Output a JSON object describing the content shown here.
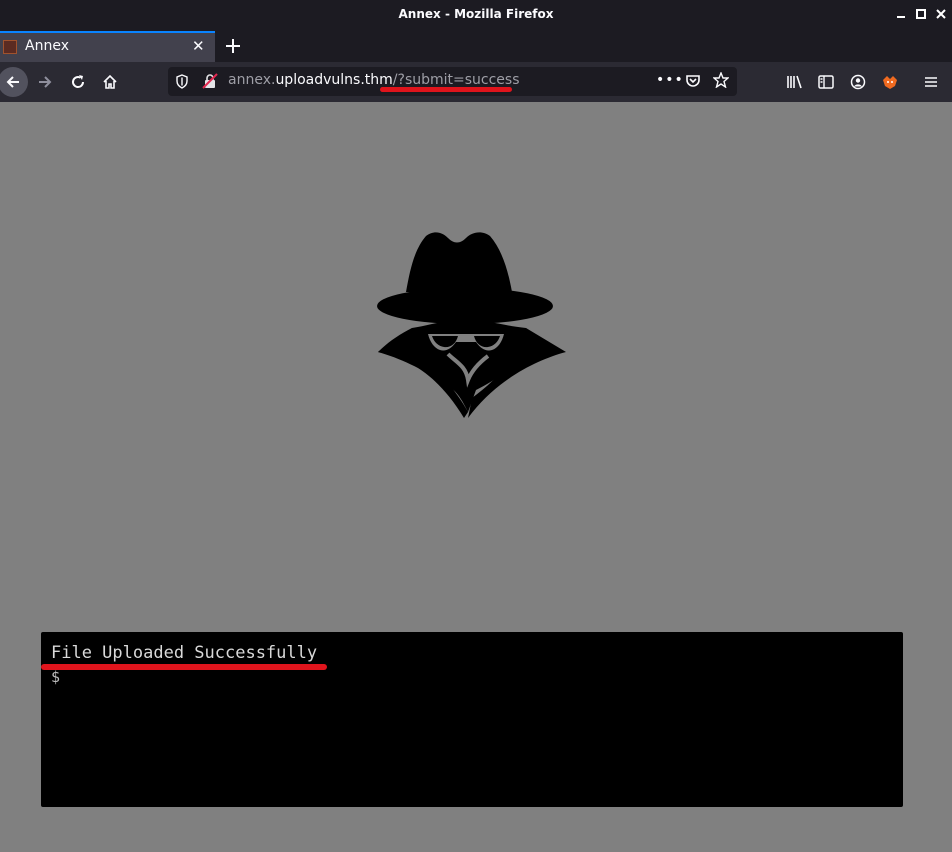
{
  "window": {
    "title": "Annex - Mozilla Firefox"
  },
  "tabs": [
    {
      "label": "Annex"
    }
  ],
  "urlbar": {
    "prefix": "annex.",
    "host": "uploadvulns.thm",
    "path": "/?submit=success"
  },
  "terminal": {
    "message": "File Uploaded Successfully",
    "prompt": "$"
  },
  "colors": {
    "annotation": "#e0141c",
    "page_bg": "#808080",
    "terminal_bg": "#000000"
  }
}
